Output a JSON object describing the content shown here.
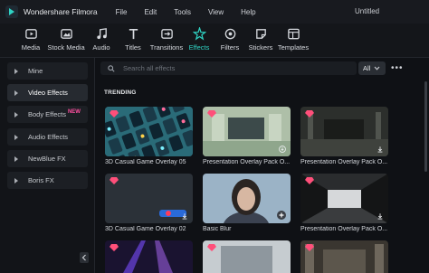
{
  "app": {
    "name": "Wondershare Filmora",
    "document_title": "Untitled"
  },
  "menu": [
    "File",
    "Edit",
    "Tools",
    "View",
    "Help"
  ],
  "toolbar": [
    {
      "label": "Media",
      "icon": "media-icon"
    },
    {
      "label": "Stock Media",
      "icon": "stock-media-icon"
    },
    {
      "label": "Audio",
      "icon": "music-note-icon"
    },
    {
      "label": "Titles",
      "icon": "text-icon"
    },
    {
      "label": "Transitions",
      "icon": "transitions-icon"
    },
    {
      "label": "Effects",
      "icon": "effects-icon",
      "active": true
    },
    {
      "label": "Filters",
      "icon": "filters-icon"
    },
    {
      "label": "Stickers",
      "icon": "stickers-icon"
    },
    {
      "label": "Templates",
      "icon": "templates-icon"
    }
  ],
  "sidebar": {
    "items": [
      {
        "label": "Mine"
      },
      {
        "label": "Video Effects",
        "active": true
      },
      {
        "label": "Body Effects",
        "badge": "NEW"
      },
      {
        "label": "Audio Effects"
      },
      {
        "label": "NewBlue FX"
      },
      {
        "label": "Boris FX"
      }
    ]
  },
  "search": {
    "placeholder": "Search all effects"
  },
  "filter": {
    "value": "All"
  },
  "section_title": "TRENDING",
  "cards": [
    {
      "label": "3D Casual Game Overlay 05",
      "premium": true
    },
    {
      "label": "Presentation Overlay Pack O...",
      "premium": true
    },
    {
      "label": "Presentation Overlay Pack O...",
      "premium": true
    },
    {
      "label": "3D Casual Game Overlay 02",
      "premium": true
    },
    {
      "label": "Basic Blur",
      "premium": false
    },
    {
      "label": "Presentation Overlay Pack O...",
      "premium": true
    },
    {
      "label": "",
      "premium": true
    },
    {
      "label": "",
      "premium": true
    },
    {
      "label": "",
      "premium": true
    }
  ],
  "colors": {
    "accent": "#2fd3c4",
    "premium_gem": "#ff4f7a",
    "new_badge": "#ff4fa0",
    "background": "#0f1115"
  }
}
